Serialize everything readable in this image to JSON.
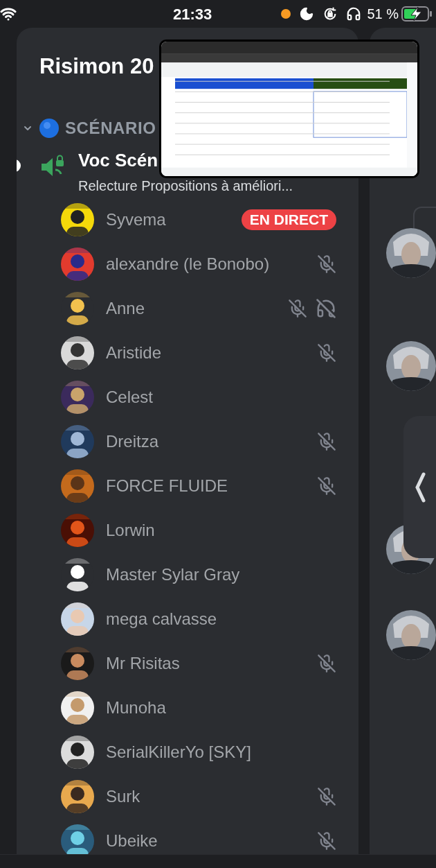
{
  "status_bar": {
    "time": "21:33",
    "battery": "51 %"
  },
  "server": {
    "title": "Risimon 20"
  },
  "category": {
    "name": "SCÉNARIO",
    "expanded": true
  },
  "voice_channel": {
    "name": "Voc Scén",
    "status": "Relecture Propositions à améliori...",
    "selected": true
  },
  "users": [
    {
      "name": "Syvema",
      "badge": "EN DIRECT",
      "muted": false,
      "deafened": false
    },
    {
      "name": "alexandre (le Bonobo)",
      "muted": true,
      "deafened": false
    },
    {
      "name": "Anne",
      "muted": true,
      "deafened": true
    },
    {
      "name": "Aristide",
      "muted": true,
      "deafened": false
    },
    {
      "name": "Celest",
      "muted": false,
      "deafened": false
    },
    {
      "name": "Dreitza",
      "muted": true,
      "deafened": false
    },
    {
      "name": "FORCE FLUIDE",
      "muted": true,
      "deafened": false
    },
    {
      "name": "Lorwin",
      "muted": false,
      "deafened": false
    },
    {
      "name": "Master Sylar Gray",
      "muted": false,
      "deafened": false
    },
    {
      "name": "mega calvasse",
      "muted": false,
      "deafened": false
    },
    {
      "name": "Mr Risitas",
      "muted": true,
      "deafened": false
    },
    {
      "name": "Munoha",
      "muted": false,
      "deafened": false
    },
    {
      "name": "SerialKillerYo [SKY]",
      "muted": false,
      "deafened": false
    },
    {
      "name": "Surk",
      "muted": true,
      "deafened": false
    },
    {
      "name": "Ubeike",
      "muted": true,
      "deafened": false
    }
  ]
}
